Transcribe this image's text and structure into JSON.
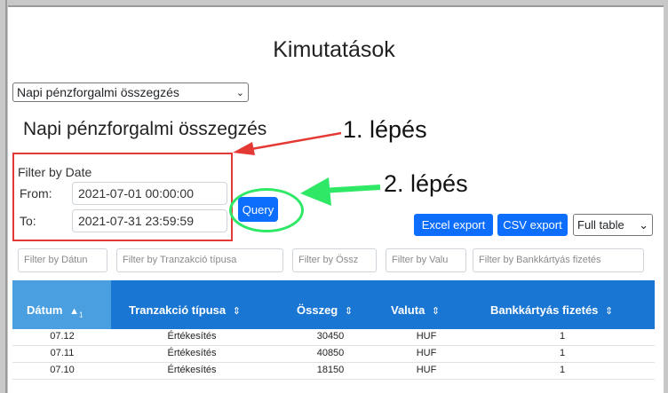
{
  "page_title": "Kimutatások",
  "report_select": {
    "value": "Napi pénzforgalmi összegzés"
  },
  "section_title": "Napi pénzforgalmi összegzés",
  "date_filter": {
    "label": "Filter by Date",
    "from_label": "From:",
    "from_value": "2021-07-01 00:00:00",
    "to_label": "To:",
    "to_value": "2021-07-31 23:59:59",
    "query_label": "Query"
  },
  "annotations": {
    "step1": "1. lépés",
    "step2": "2. lépés",
    "box_color": "#e53935",
    "ring_color": "#2ee866"
  },
  "toolbar": {
    "excel_export": "Excel export",
    "csv_export": "CSV export",
    "table_mode": "Full table"
  },
  "column_filters": [
    "Filter by Dátun",
    "Filter by Tranzakció típusa",
    "Filter by Össz",
    "Filter by Valu",
    "Filter by Bankkártyás fizetés"
  ],
  "table": {
    "header_color": "#1976d2",
    "sorted_header_color": "#4a9fe0",
    "columns": [
      "Dátum",
      "Tranzakció típusa",
      "Összeg",
      "Valuta",
      "Bankkártyás fizetés"
    ],
    "sort_index": "1",
    "rows": [
      [
        "07.12",
        "Értékesítés",
        "30450",
        "HUF",
        "1"
      ],
      [
        "07.11",
        "Értékesítés",
        "40850",
        "HUF",
        "1"
      ],
      [
        "07.10",
        "Értékesítés",
        "18150",
        "HUF",
        "1"
      ]
    ]
  }
}
